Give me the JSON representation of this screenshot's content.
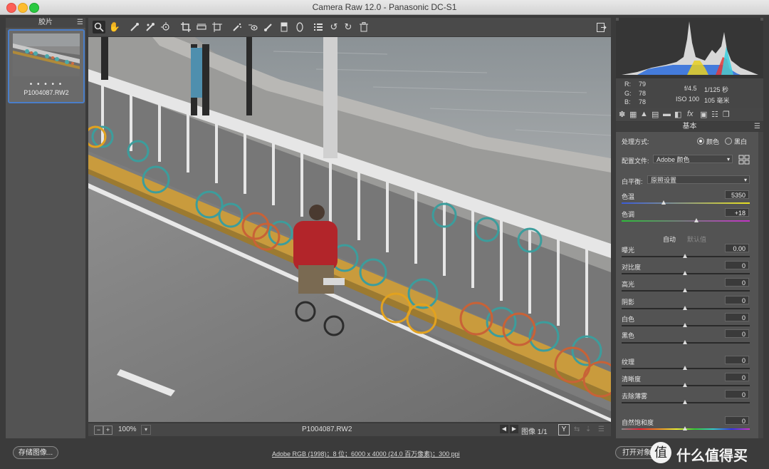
{
  "window": {
    "title": "Camera Raw 12.0 -  Panasonic DC-S1"
  },
  "filmstrip": {
    "title": "胶片",
    "thumb_name": "P1004087.RW2",
    "dots": "• • • • •"
  },
  "toolbar": {
    "icons": [
      "zoom-icon",
      "hand-icon",
      "white-balance-icon",
      "color-sampler-icon",
      "targeted-adjustment-icon",
      "crop-icon",
      "straighten-icon",
      "transform-icon",
      "spot-removal-icon",
      "red-eye-icon",
      "adjustment-brush-icon",
      "graduated-filter-icon",
      "radial-filter-icon",
      "presets-list-icon",
      "rotate-left-icon",
      "rotate-right-icon",
      "trash-icon"
    ]
  },
  "canvas_bar": {
    "zoom": "100%",
    "filename": "P1004087.RW2",
    "image_count": "图像 1/1",
    "y_label": "Y"
  },
  "info": {
    "r_label": "R:",
    "r_val": "79",
    "g_label": "G:",
    "g_val": "78",
    "b_label": "B:",
    "b_val": "78",
    "aperture": "f/4.5",
    "shutter": "1/125 秒",
    "iso": "ISO 100",
    "focal": "105 毫米"
  },
  "panel": {
    "title": "基本",
    "treatment_label": "处理方式:",
    "treatment_color": "颜色",
    "treatment_bw": "黑白",
    "profile_label": "配置文件:",
    "profile_value": "Adobe 颜色",
    "wb_label": "白平衡:",
    "wb_value": "原照设置",
    "temp_label": "色温",
    "temp_value": "5350",
    "tint_label": "色调",
    "tint_value": "+18",
    "auto_label": "自动",
    "default_label": "默认值",
    "sliders": [
      {
        "label": "曝光",
        "value": "0.00"
      },
      {
        "label": "对比度",
        "value": "0"
      },
      {
        "label": "高光",
        "value": "0"
      },
      {
        "label": "阴影",
        "value": "0"
      },
      {
        "label": "白色",
        "value": "0"
      },
      {
        "label": "黑色",
        "value": "0"
      },
      {
        "label": "纹理",
        "value": "0"
      },
      {
        "label": "清晰度",
        "value": "0"
      },
      {
        "label": "去除薄雾",
        "value": "0"
      },
      {
        "label": "自然饱和度",
        "value": "0"
      }
    ]
  },
  "bottom": {
    "save_label": "存储图像...",
    "workflow": "Adobe RGB (1998)；8 位；6000 x 4000 (24.0 百万像素)；300 ppi",
    "open_label": "打开对象",
    "watermark": "什么值得买"
  }
}
